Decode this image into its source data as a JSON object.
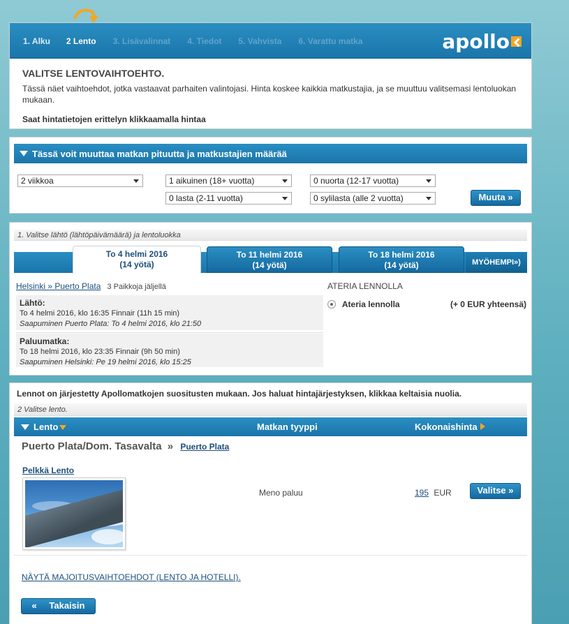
{
  "steps": [
    {
      "label": "1. Alku",
      "state": "done"
    },
    {
      "label": "2 Lento",
      "state": "current"
    },
    {
      "label": "3. Lisävalinnat",
      "state": "pending"
    },
    {
      "label": "4. Tiedot",
      "state": "pending"
    },
    {
      "label": "5. Vahvista",
      "state": "pending"
    },
    {
      "label": "6. Varattu matka",
      "state": "pending"
    }
  ],
  "brand": {
    "name": "apollo"
  },
  "intro": {
    "heading": "VALITSE LENTOVAIHTOEHTO.",
    "text": "Tässä näet vaihtoehdot, jotka vastaavat parhaiten valintojasi. Hinta koskee kaikkia matkustajia, ja se muuttuu valitsemasi lentoluokan mukaan.",
    "note": "Saat hintatietojen erittelyn klikkaamalla hintaa"
  },
  "change": {
    "title": "Tässä voit muuttaa matkan pituutta ja matkustajien määrää",
    "duration": "2 viikkoa",
    "adults": "1 aikuinen (18+ vuotta)",
    "youth": "0 nuorta (12-17 vuotta)",
    "children": "0 lasta (2-11 vuotta)",
    "infants": "0 sylilasta (alle 2 vuotta)",
    "button": "Muuta »"
  },
  "dates": {
    "step_label": "1. Valitse lähtö (lähtöpäivämäärä) ja lentoluokka",
    "tabs": [
      {
        "line1": "To 4 helmi 2016",
        "line2": "(14 yötä)",
        "active": true
      },
      {
        "line1": "To 11 helmi 2016",
        "line2": "(14 yötä)",
        "active": false
      },
      {
        "line1": "To 18 helmi 2016",
        "line2": "(14 yötä)",
        "active": false
      }
    ],
    "later": "MYÖHEMPI»)"
  },
  "flight": {
    "route": "Helsinki » Puerto Plata",
    "seats": "3 Paikkoja jäljellä",
    "outbound_title": "Lähtö:",
    "outbound_detail": "To 4 helmi 2016, klo 16:35 Finnair (11h 15 min)",
    "outbound_arrival": "Saapuminen Puerto Plata: To 4 helmi 2016, klo 21:50",
    "return_title": "Paluumatka:",
    "return_detail": "To 18 helmi 2016, klo 23:35 Finnair (9h 50 min)",
    "return_arrival": "Saapuminen Helsinki: Pe 19 helmi 2016, klo 15:25"
  },
  "meal": {
    "title": "ATERIA LENNOLLA",
    "option": "Ateria lennolla",
    "price": "(+ 0 EUR yhteensä)"
  },
  "results": {
    "note": "Lennot on järjestetty Apollomatkojen suositusten mukaan. Jos haluat hintajärjestyksen, klikkaa keltaisia nuolia.",
    "step_label": "2 Valitse lento.",
    "col_flight": "Lento",
    "col_type": "Matkan tyyppi",
    "col_total": "Kokonaishinta",
    "destination": "Puerto Plata/Dom. Tasavalta",
    "destination_sep": "»",
    "destination_link": "Puerto Plata",
    "package_title": "Pelkkä Lento",
    "trip_type": "Meno paluu",
    "price_value": "195",
    "price_currency": "EUR",
    "select_button": "Valitse »",
    "more_link": "NÄYTÄ MAJOITUSVAIHTOEHDOT (LENTO JA HOTELLI).",
    "back_symbol": "«",
    "back_button": "Takaisin"
  },
  "colors": {
    "accent_blue": "#1a75aa",
    "arrow_orange": "#f5a623"
  }
}
